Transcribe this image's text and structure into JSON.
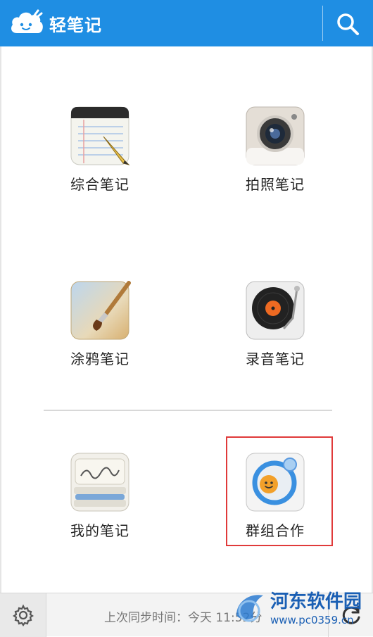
{
  "header": {
    "title": "轻笔记"
  },
  "tiles": [
    {
      "label": "综合笔记"
    },
    {
      "label": "拍照笔记"
    },
    {
      "label": "涂鸦笔记"
    },
    {
      "label": "录音笔记"
    },
    {
      "label": "我的笔记"
    },
    {
      "label": "群组合作"
    }
  ],
  "footer": {
    "sync_text": "上次同步时间：今天 11:52分"
  },
  "watermark": {
    "title": "河东软件园",
    "url": "www.pc0359.cn"
  },
  "icons": {
    "logo": "cloud-logo-icon",
    "search": "search-icon",
    "settings": "gear-icon",
    "refresh": "refresh-icon"
  },
  "colors": {
    "header": "#1f8ee3",
    "highlight": "#e03a3a",
    "watermark": "#1a5fb4"
  }
}
